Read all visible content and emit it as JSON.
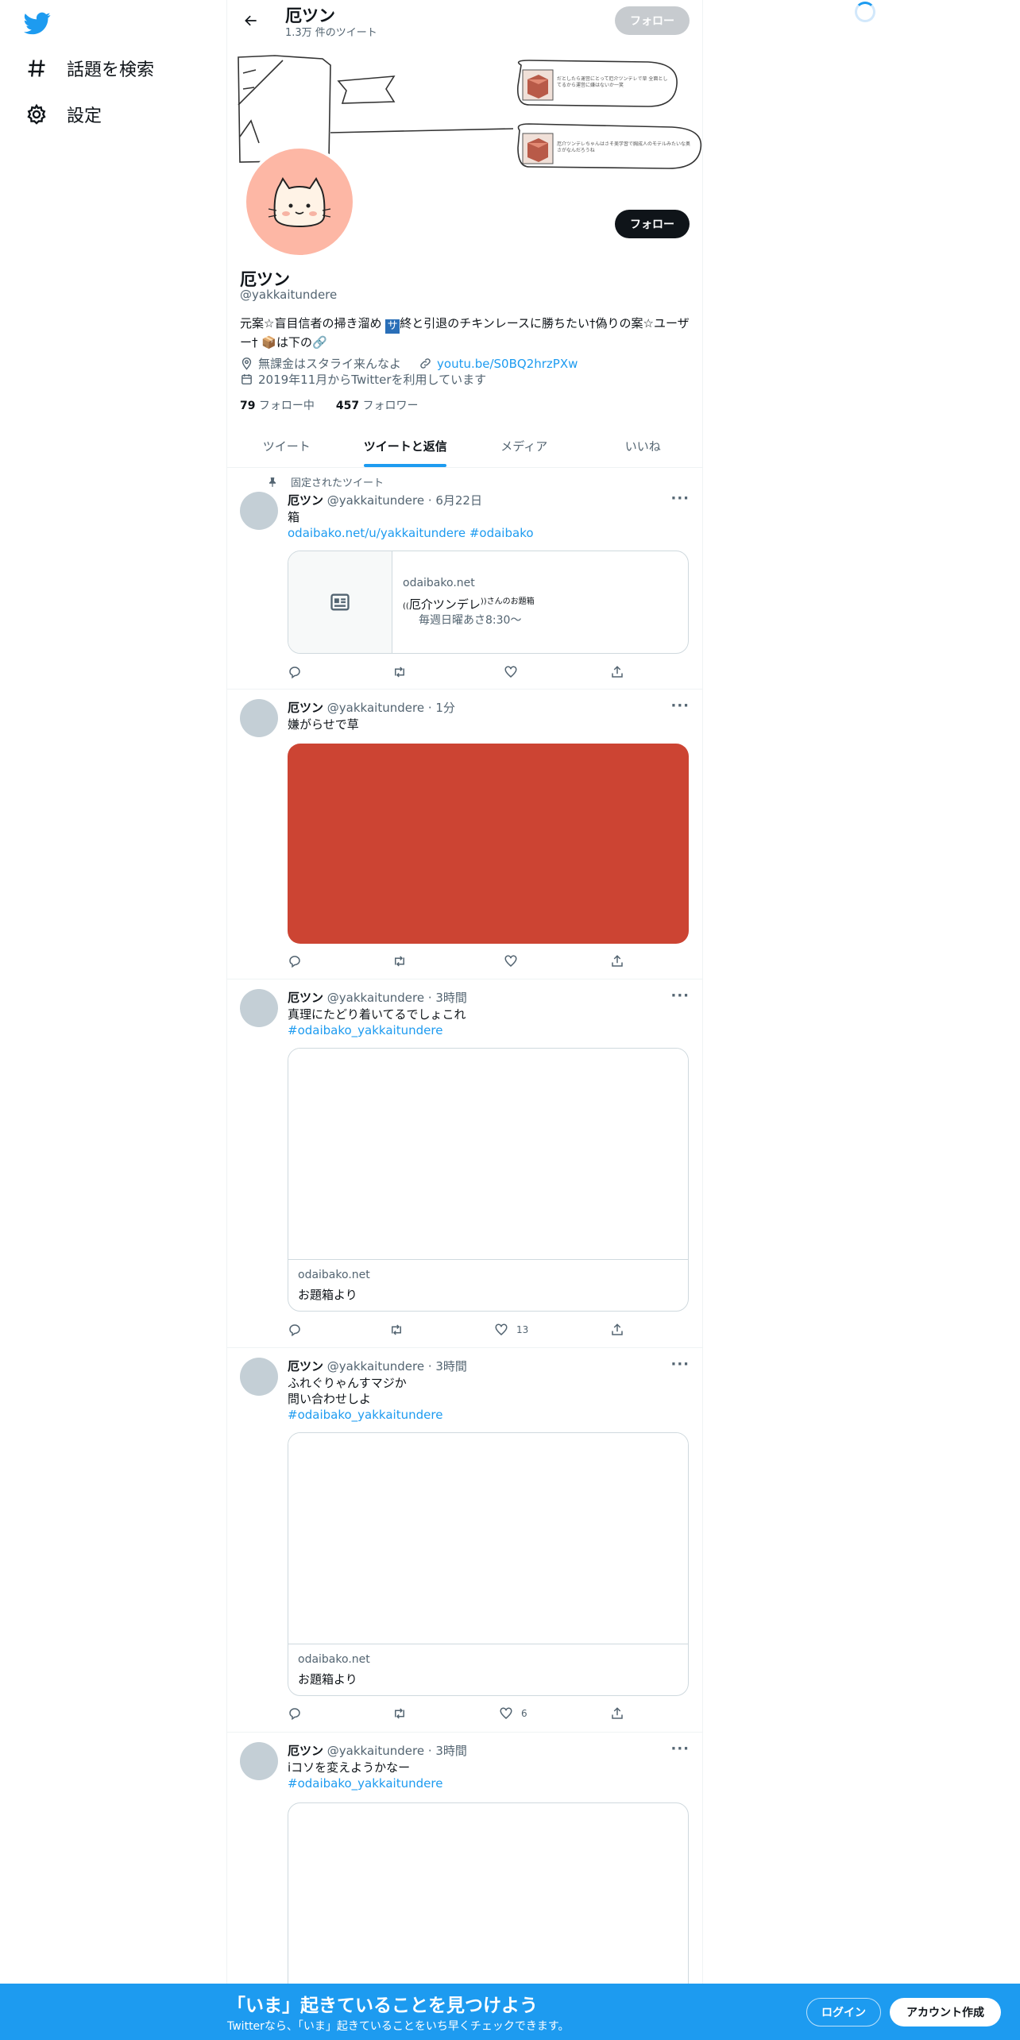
{
  "sidebar": {
    "items": [
      {
        "label": "話題を検索",
        "icon": "hashtag-icon"
      },
      {
        "label": "設定",
        "icon": "gear-icon"
      }
    ]
  },
  "header": {
    "name": "厄ツン",
    "tweet_count": "1.3万 件のツイート",
    "follow_label": "フォロー"
  },
  "banner": {
    "bubble1": "だとしたら運営にとって厄介ツンデレで草 全面としてるから運営に嫌はないか一笑",
    "bubble2": "厄介ツンデレちゃんはさそ美学習で胸成人のモデルみたいな奥さがなんだろうね"
  },
  "profile": {
    "name": "厄ツン",
    "handle": "@yakkaitundere",
    "bio_part1": "元案☆盲目信者の掃き溜め ",
    "bio_square": "サ",
    "bio_part2": "終と引退のチキンレースに勝ちたい†偽りの案☆ユーザー† ",
    "bio_box": "📦",
    "bio_part3": "は下の",
    "bio_link_emoji": "🔗",
    "location": "無課金はスタライ来んなよ",
    "url": "youtu.be/S0BQ2hrzPXw",
    "joined": "2019年11月からTwitterを利用しています",
    "following_count": "79",
    "following_label": " フォロー中",
    "followers_count": "457",
    "followers_label": " フォロワー",
    "follow_label": "フォロー"
  },
  "tabs": [
    "ツイート",
    "ツイートと返信",
    "メディア",
    "いいね"
  ],
  "tweets": [
    {
      "pinned_label": "固定されたツイート",
      "name": "厄ツン",
      "meta": "@yakkaitundere · 6月22日",
      "text1": "箱",
      "link": "odaibako.net/u/yakkaitundere #odaibako",
      "card_domain": "odaibako.net",
      "card_title_pre": "((",
      "card_title": "厄介ツンデレ",
      "card_title_post": "))さんのお題箱",
      "card_desc": "毎週日曜あさ8:30〜"
    },
    {
      "name": "厄ツン",
      "meta": "@yakkaitundere · 1分",
      "text1": "嫌がらせで草",
      "image_color": "#cc4433"
    },
    {
      "name": "厄ツン",
      "meta": "@yakkaitundere · 3時間",
      "text1": "真理にたどり着いてるでしょこれ",
      "link": "#odaibako_yakkaitundere",
      "card_domain": "odaibako.net",
      "card_title": "お題箱より",
      "likes": "13"
    },
    {
      "name": "厄ツン",
      "meta": "@yakkaitundere · 3時間",
      "text1": "ふれぐりゃんすマジか",
      "text2": "問い合わせしよ",
      "link": "#odaibako_yakkaitundere",
      "card_domain": "odaibako.net",
      "card_title": "お題箱より",
      "likes": "6"
    },
    {
      "name": "厄ツン",
      "meta": "@yakkaitundere · 3時間",
      "text1": "iコソを変えようかなー",
      "link": "#odaibako_yakkaitundere"
    }
  ],
  "bottom_bar": {
    "title": "「いま」起きていることを見つけよう",
    "subtitle": "Twitterなら、「いま」起きていることをいち早くチェックできます。",
    "login_label": "ログイン",
    "signup_label": "アカウント作成"
  }
}
